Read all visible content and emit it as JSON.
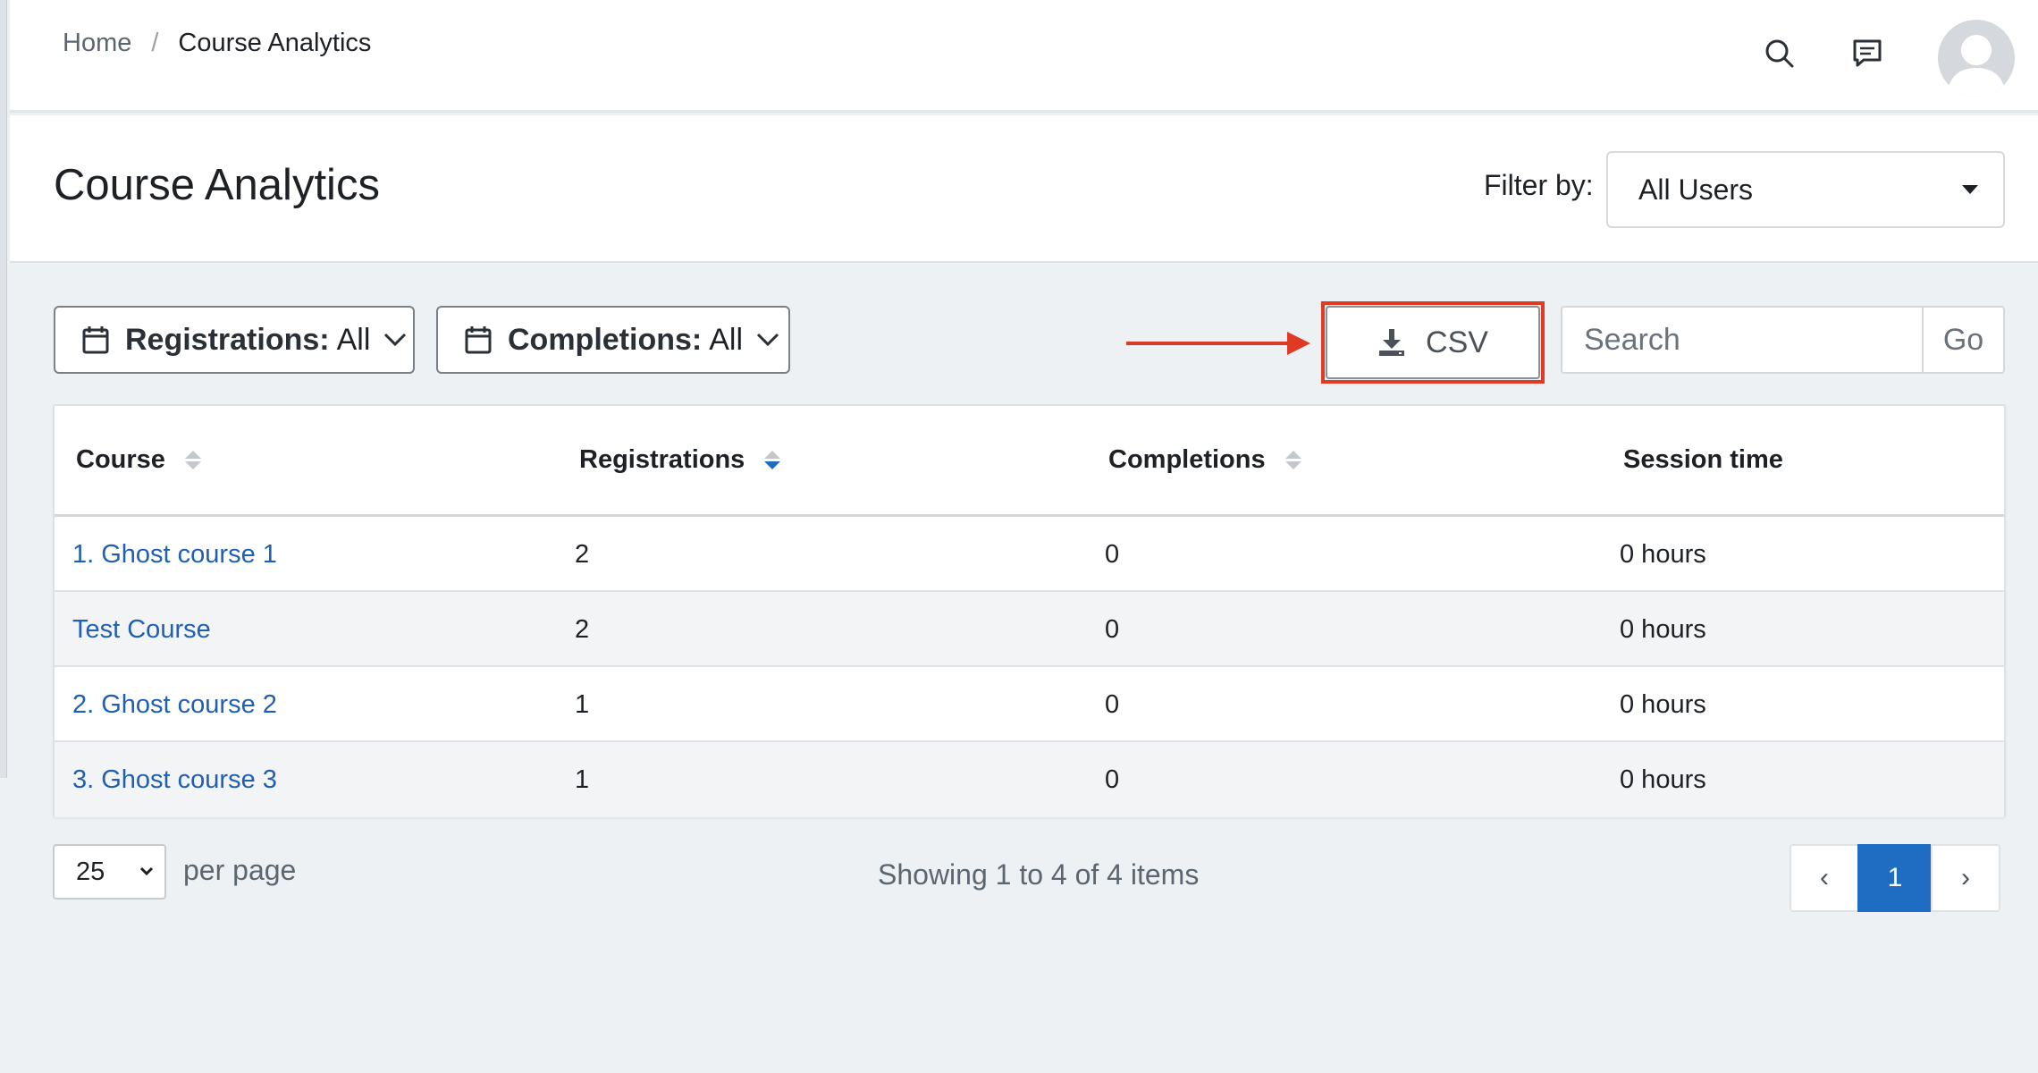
{
  "breadcrumb": {
    "home": "Home",
    "separator": "/",
    "current": "Course Analytics"
  },
  "nav": {
    "search_icon": "search-icon",
    "messages_icon": "chat-icon",
    "avatar": "user-avatar"
  },
  "header": {
    "title": "Course Analytics",
    "filter_label": "Filter by:",
    "filter_value": "All Users"
  },
  "toolbar": {
    "registrations_label": "Registrations:",
    "registrations_value": "All",
    "completions_label": "Completions:",
    "completions_value": "All",
    "csv_label": "CSV",
    "search_placeholder": "Search",
    "go_label": "Go"
  },
  "table": {
    "columns": [
      "Course",
      "Registrations",
      "Completions",
      "Session time"
    ],
    "rows": [
      {
        "course": "1. Ghost course 1",
        "registrations": "2",
        "completions": "0",
        "session": "0 hours"
      },
      {
        "course": "Test Course",
        "registrations": "2",
        "completions": "0",
        "session": "0 hours"
      },
      {
        "course": "2. Ghost course 2",
        "registrations": "1",
        "completions": "0",
        "session": "0 hours"
      },
      {
        "course": "3. Ghost course 3",
        "registrations": "1",
        "completions": "0",
        "session": "0 hours"
      }
    ]
  },
  "footer": {
    "per_page_value": "25",
    "per_page_label": "per page",
    "showing": "Showing 1 to 4 of 4 items",
    "prev": "‹",
    "current_page": "1",
    "next": "›"
  },
  "colors": {
    "accent": "#1f6dc2",
    "link": "#1f5fb4",
    "annotation": "#e03a25"
  }
}
